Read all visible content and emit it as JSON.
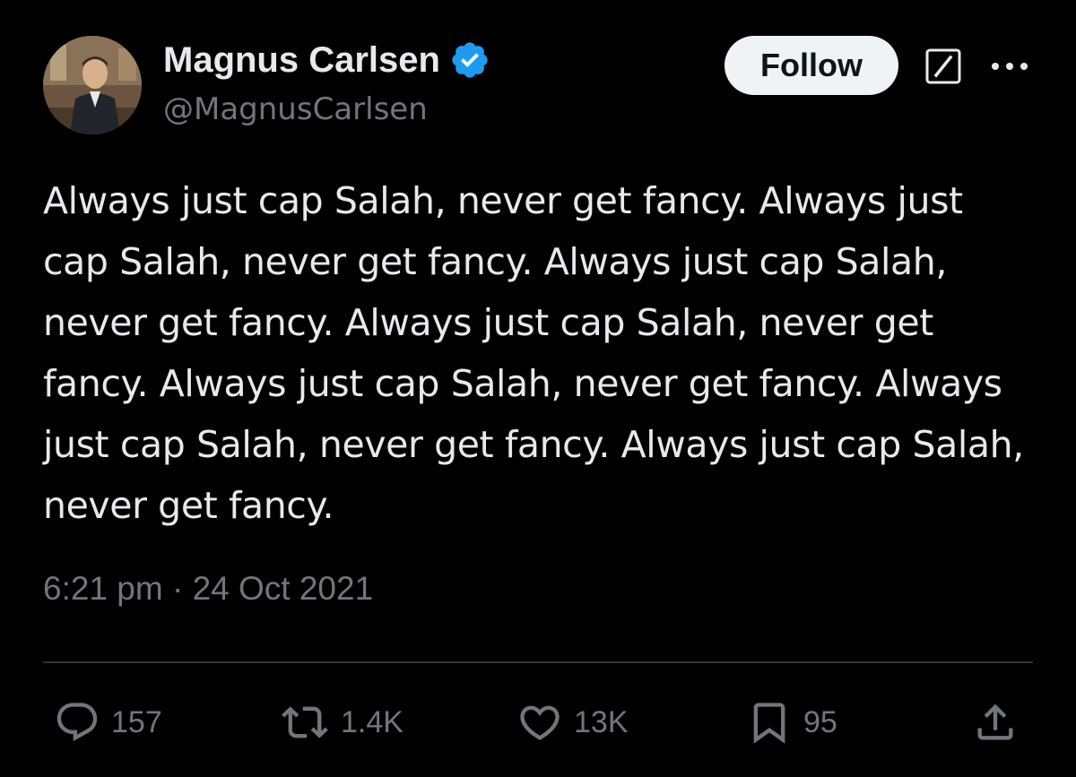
{
  "author": {
    "display_name": "Magnus Carlsen",
    "handle": "@MagnusCarlsen",
    "verified": true,
    "verified_color": "#1d9bf0"
  },
  "header": {
    "follow_label": "Follow",
    "grok_icon": "grok-icon",
    "more_icon": "more-horizontal-icon"
  },
  "tweet": {
    "text": "Always just cap Salah, never get fancy. Always just cap Salah, never get fancy. Always just cap Salah, never get fancy. Always just cap Salah, never get fancy. Always just cap Salah, never get fancy. Always just cap Salah, never get fancy. Always just cap Salah, never get fancy.",
    "timestamp": "6:21 pm · 24 Oct 2021"
  },
  "actions": {
    "replies": "157",
    "retweets": "1.4K",
    "likes": "13K",
    "bookmarks": "95"
  },
  "colors": {
    "background": "#000000",
    "text_primary": "#e7e9ea",
    "text_secondary": "#71767b",
    "divider": "#2f3336",
    "follow_bg": "#eff3f4"
  }
}
